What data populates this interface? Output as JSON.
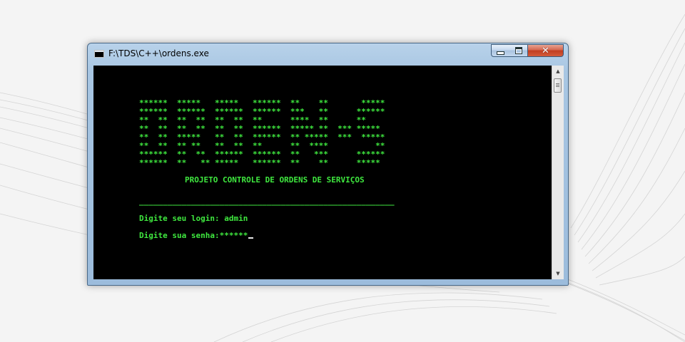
{
  "window": {
    "title": "F:\\TDS\\C++\\ordens.exe",
    "controls": {
      "minimize": "minimize",
      "maximize": "maximize",
      "close": "✕"
    }
  },
  "console": {
    "banner_lines": [
      "******  *****   *****   ******  **    **       *****",
      "******  ******  ******  ******  ***   **      ******",
      "**  **  **  **  **  **  **      ****  **      **",
      "**  **  **  **  **  **  ******  ***** **  *** *****",
      "**  **  *****   **  **  ******  ** *****  ***  *****",
      "**  **  ** **   **  **  **      **  ****          **",
      "******  **  **  ******  ******  **   ***      ******",
      "******  **   ** *****   ******  **    **      *****"
    ],
    "subtitle": "PROJETO CONTROLE DE ORDENS DE SERVIÇOS",
    "separator": "______________________________________________________",
    "login_line": "Digite seu login: admin",
    "password_line": "Digite sua senha:******"
  },
  "icons": {
    "app": "console-app-icon",
    "scroll_up": "▲",
    "scroll_down": "▼"
  }
}
